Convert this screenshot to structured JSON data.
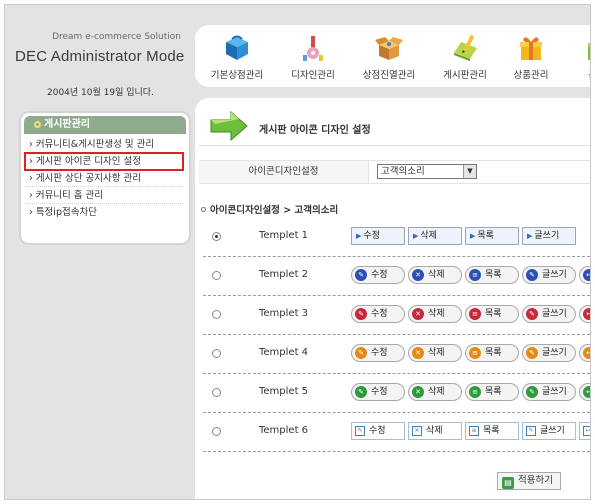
{
  "brand": {
    "subtitle": "Dream e-commerce Solution",
    "title": "DEC Administrator Mode",
    "date": "2004년 10월 19일 입니다."
  },
  "sidebar": {
    "heading": "게시판관리",
    "items": [
      {
        "label": "› 커뮤니티&게시판생성 및 관리",
        "active": false
      },
      {
        "label": "› 게시판 아이콘 디자인 설정",
        "active": true
      },
      {
        "label": "› 게시판 상단 공지사항 관리",
        "active": false
      },
      {
        "label": "› 커뮤니티 홈 관리",
        "active": false
      },
      {
        "label": "› 특정ip접속차단",
        "active": false
      }
    ]
  },
  "topnav": {
    "items": [
      {
        "label": "기본상점관리",
        "icon": "cube-icon"
      },
      {
        "label": "디자인관리",
        "icon": "design-tools-icon"
      },
      {
        "label": "상점진열관리",
        "icon": "open-box-icon"
      },
      {
        "label": "게시판관리",
        "icon": "notebook-pencil-icon"
      },
      {
        "label": "상품관리",
        "icon": "gift-box-icon"
      },
      {
        "label": "공구",
        "icon": "group-buy-icon"
      }
    ]
  },
  "page": {
    "title": "게시판 아이콘 디자인 설정",
    "setting_label": "아이콘디자인설정",
    "select_value": "고객의소리",
    "breadcrumb": "아이콘디자인설정 > 고객의소리",
    "apply_label": "적용하기"
  },
  "templates": [
    {
      "name": "Templet 1",
      "checked": true,
      "style": "s1",
      "color": null,
      "buttons": [
        "수정",
        "삭제",
        "목록",
        "글쓰기"
      ]
    },
    {
      "name": "Templet 2",
      "checked": false,
      "style": "pill",
      "colors": [
        "#2b4fb6",
        "#2b4fb6",
        "#2b4fb6",
        "#2b4fb6"
      ],
      "buttons": [
        "수정",
        "삭제",
        "목록",
        "글쓰기",
        "답"
      ]
    },
    {
      "name": "Templet 3",
      "checked": false,
      "style": "pill",
      "colors": [
        "#c8283a",
        "#c8283a",
        "#c8283a",
        "#c8283a"
      ],
      "buttons": [
        "수정",
        "삭제",
        "목록",
        "글쓰기",
        "답"
      ]
    },
    {
      "name": "Templet 4",
      "checked": false,
      "style": "pill",
      "colors": [
        "#e38a19",
        "#e38a19",
        "#e38a19",
        "#e38a19"
      ],
      "buttons": [
        "수정",
        "삭제",
        "목록",
        "글쓰기",
        "답"
      ]
    },
    {
      "name": "Templet 5",
      "checked": false,
      "style": "pill",
      "colors": [
        "#2f9a3b",
        "#2f9a3b",
        "#2f9a3b",
        "#2f9a3b"
      ],
      "buttons": [
        "수정",
        "삭제",
        "목록",
        "글쓰기",
        "답"
      ]
    },
    {
      "name": "Templet 6",
      "checked": false,
      "style": "s6",
      "color": "#3b84b8",
      "buttons": [
        "수정",
        "삭제",
        "목록",
        "글쓰기",
        "답변"
      ]
    }
  ]
}
